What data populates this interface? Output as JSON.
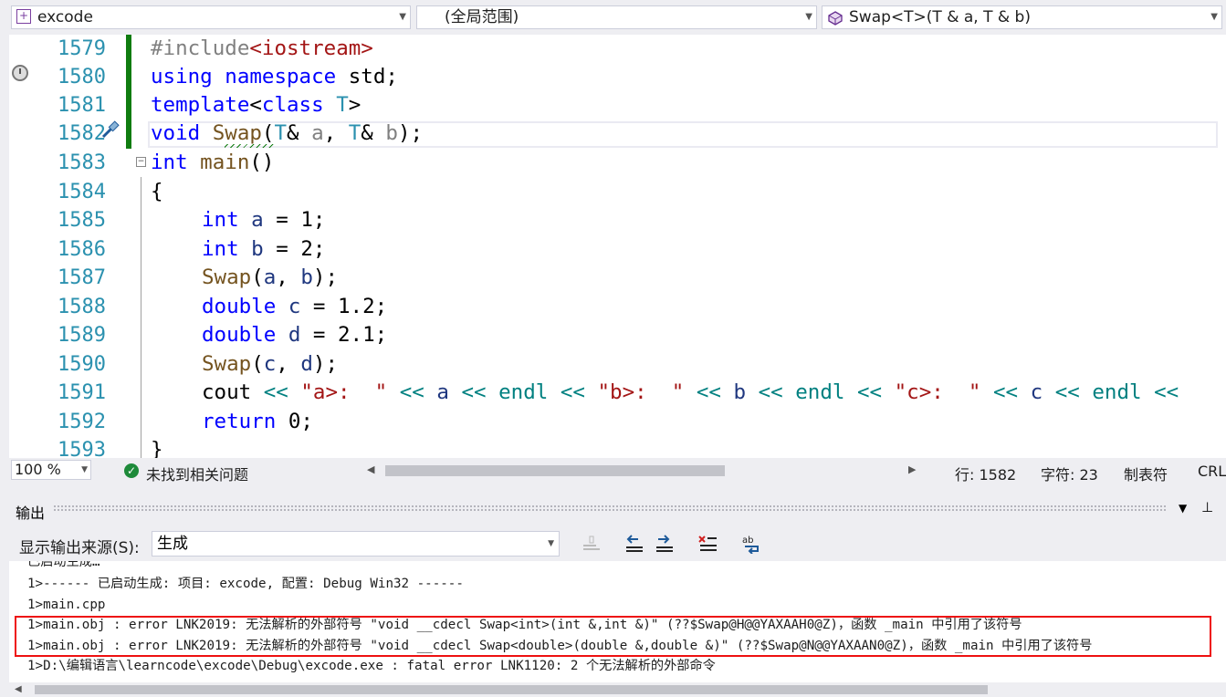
{
  "navbar": {
    "project": "excode",
    "scope": "(全局范围)",
    "member": "Swap<T>(T & a, T & b)"
  },
  "editor": {
    "lines": [
      {
        "num": "1579"
      },
      {
        "num": "1580"
      },
      {
        "num": "1581"
      },
      {
        "num": "1582"
      },
      {
        "num": "1583"
      },
      {
        "num": "1584"
      },
      {
        "num": "1585"
      },
      {
        "num": "1586"
      },
      {
        "num": "1587"
      },
      {
        "num": "1588"
      },
      {
        "num": "1589"
      },
      {
        "num": "1590"
      },
      {
        "num": "1591"
      },
      {
        "num": "1592"
      },
      {
        "num": "1593"
      }
    ],
    "code": {
      "l1579_a": "#include",
      "l1579_b": "<iostream>",
      "l1580_a": "using",
      "l1580_b": " namespace",
      "l1580_c": " std;",
      "l1581_a": "template",
      "l1581_b": "<",
      "l1581_c": "class",
      "l1581_d": " T",
      "l1581_e": ">",
      "l1582_void": "void",
      "l1582_swap": "Swap",
      "l1582_p1": "(",
      "l1582_t1": "T",
      "l1582_amp1": "& ",
      "l1582_a": "a",
      "l1582_comma": ", ",
      "l1582_t2": "T",
      "l1582_amp2": "& ",
      "l1582_b": "b",
      "l1582_end": ");",
      "l1583_int": "int",
      "l1583_main": " main",
      "l1583_par": "()",
      "l1584": "{",
      "l1585_int": "int",
      "l1585_a": " a",
      "l1585_rest": " = 1;",
      "l1586_int": "int",
      "l1586_b": " b",
      "l1586_rest": " = 2;",
      "l1587_swap": "Swap",
      "l1587_p": "(",
      "l1587_a": "a",
      "l1587_c": ", ",
      "l1587_b": "b",
      "l1587_e": ");",
      "l1588_dbl": "double",
      "l1588_c": " c",
      "l1588_rest": " = 1.2;",
      "l1589_dbl": "double",
      "l1589_d": " d",
      "l1589_rest": " = 2.1;",
      "l1590_swap": "Swap",
      "l1590_p": "(",
      "l1590_c": "c",
      "l1590_cm": ", ",
      "l1590_d": "d",
      "l1590_e": ");",
      "l1591_cout": "cout",
      "l1591_o1": " <<",
      "l1591_s1": " \"a>:  \"",
      "l1591_o2": " <<",
      "l1591_a": " a",
      "l1591_o3": " <<",
      "l1591_endl1": " endl",
      "l1591_o4": " <<",
      "l1591_s2": " \"b>:  \"",
      "l1591_o5": " <<",
      "l1591_b": " b",
      "l1591_o6": " <<",
      "l1591_endl2": " endl",
      "l1591_o7": " <<",
      "l1591_s3": " \"c>:  \"",
      "l1591_o8": " <<",
      "l1591_c": " c",
      "l1591_o9": " <<",
      "l1591_endl3": " endl",
      "l1591_o10": " <<",
      "l1592_ret": "return",
      "l1592_rest": " 0;",
      "l1593": "}"
    }
  },
  "status": {
    "zoom": "100 %",
    "issues": "未找到相关问题",
    "line": "行: 1582",
    "char": "字符: 23",
    "tab": "制表符",
    "eol": "CRL"
  },
  "output": {
    "title": "输出",
    "source_label": "显示输出来源(S):",
    "source_value": "生成",
    "lines": [
      "已启动生成…",
      "1>------ 已启动生成: 项目: excode, 配置: Debug Win32 ------",
      "1>main.cpp",
      "1>main.obj : error LNK2019: 无法解析的外部符号 \"void __cdecl Swap<int>(int &,int &)\" (??$Swap@H@@YAXAAH0@Z)，函数 _main 中引用了该符号",
      "1>main.obj : error LNK2019: 无法解析的外部符号 \"void __cdecl Swap<double>(double &,double &)\" (??$Swap@N@@YAXAAN0@Z)，函数 _main 中引用了该符号",
      "1>D:\\编辑语言\\learncode\\excode\\Debug\\excode.exe : fatal error LNK1120: 2 个无法解析的外部命令"
    ]
  },
  "colors": {
    "keyword": "#0000ff",
    "function": "#74531f",
    "type": "#2b91af",
    "string": "#a31515",
    "error_box": "#e11111",
    "change_bar": "#107c10"
  },
  "icons": [
    "file-icon",
    "class-member-icon",
    "history-clock-icon",
    "quick-action-screwdriver-icon",
    "check-circle-icon",
    "pin-icon",
    "close-icon",
    "clear-icon",
    "prev-message-icon",
    "next-message-icon",
    "clear-all-icon",
    "word-wrap-icon"
  ]
}
